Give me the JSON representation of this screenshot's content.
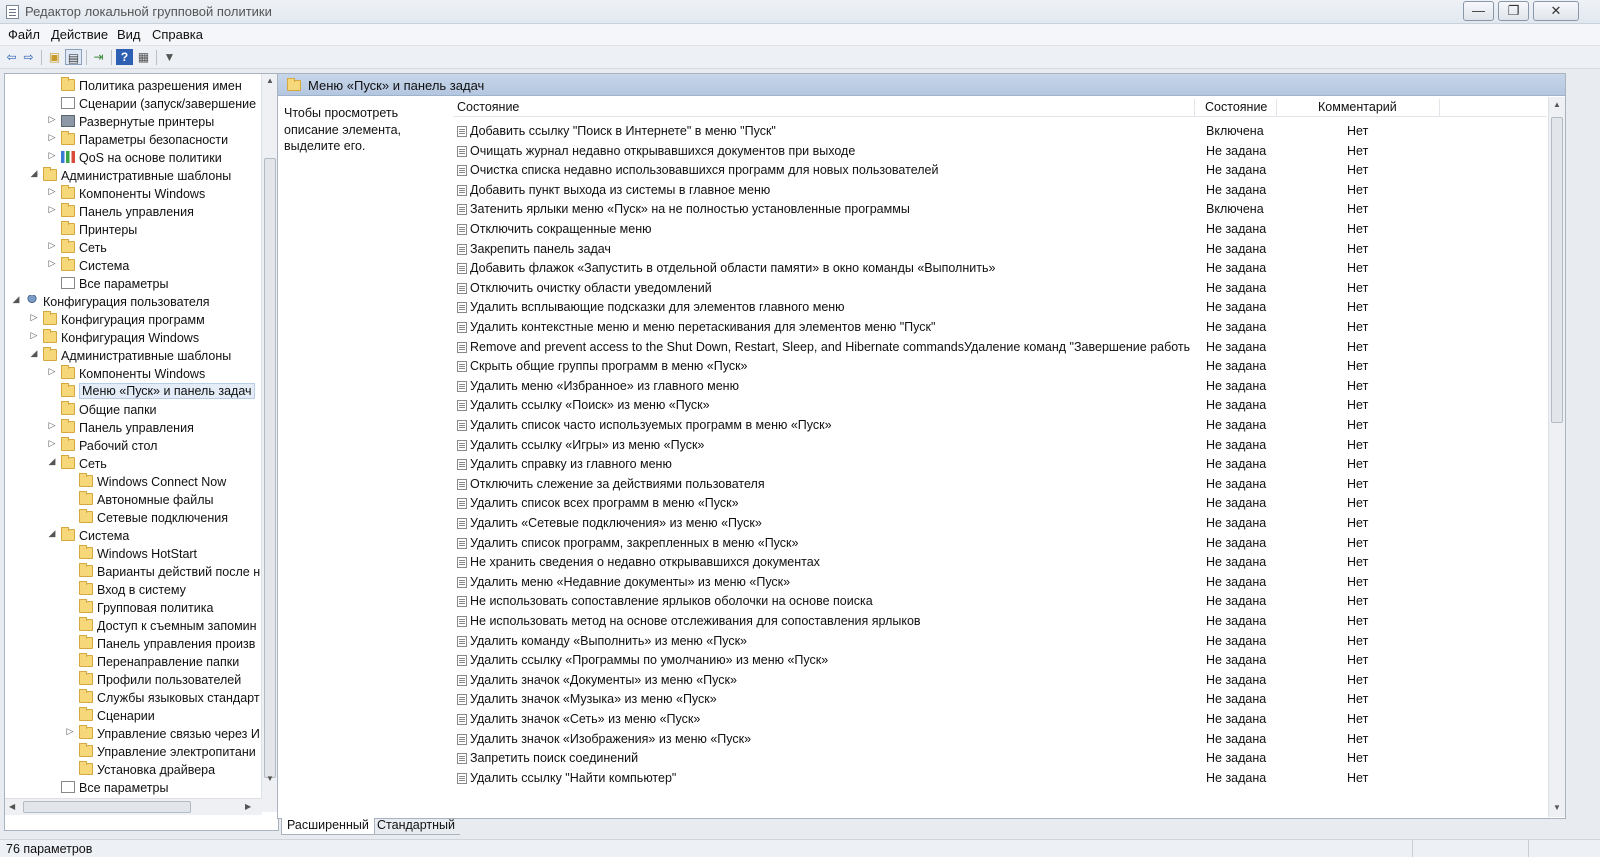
{
  "window": {
    "title": "Редактор локальной групповой политики",
    "minimize_glyph": "—",
    "restore_glyph": "❐",
    "close_glyph": "✕"
  },
  "menu": [
    "Файл",
    "Действие",
    "Вид",
    "Справка"
  ],
  "toolbar": {
    "icons": [
      "back-icon",
      "forward-icon",
      "up-folder-icon",
      "show-hide-tree-icon",
      "export-list-icon",
      "help-icon",
      "properties-icon",
      "filter-icon"
    ]
  },
  "tree": [
    {
      "label": "Политика разрешения имен",
      "level": 2,
      "expander": "",
      "icon": "folder"
    },
    {
      "label": "Сценарии (запуск/завершение",
      "level": 2,
      "expander": "",
      "icon": "doc"
    },
    {
      "label": "Развернутые принтеры",
      "level": 2,
      "expander": "▷",
      "icon": "printer"
    },
    {
      "label": "Параметры безопасности",
      "level": 2,
      "expander": "▷",
      "icon": "folder"
    },
    {
      "label": "QoS на основе политики",
      "level": 2,
      "expander": "▷",
      "icon": "chart"
    },
    {
      "label": "Административные шаблоны",
      "level": 1,
      "expander": "◢",
      "icon": "folder"
    },
    {
      "label": "Компоненты Windows",
      "level": 2,
      "expander": "▷",
      "icon": "folder"
    },
    {
      "label": "Панель управления",
      "level": 2,
      "expander": "▷",
      "icon": "folder"
    },
    {
      "label": "Принтеры",
      "level": 2,
      "expander": "",
      "icon": "folder"
    },
    {
      "label": "Сеть",
      "level": 2,
      "expander": "▷",
      "icon": "folder"
    },
    {
      "label": "Система",
      "level": 2,
      "expander": "▷",
      "icon": "folder"
    },
    {
      "label": "Все параметры",
      "level": 2,
      "expander": "",
      "icon": "doc"
    },
    {
      "label": "Конфигурация пользователя",
      "level": 0,
      "expander": "◢",
      "icon": "user"
    },
    {
      "label": "Конфигурация программ",
      "level": 1,
      "expander": "▷",
      "icon": "folder"
    },
    {
      "label": "Конфигурация Windows",
      "level": 1,
      "expander": "▷",
      "icon": "folder"
    },
    {
      "label": "Административные шаблоны",
      "level": 1,
      "expander": "◢",
      "icon": "folder"
    },
    {
      "label": "Компоненты Windows",
      "level": 2,
      "expander": "▷",
      "icon": "folder"
    },
    {
      "label": "Меню «Пуск» и панель задач",
      "level": 2,
      "expander": "",
      "icon": "folder",
      "selected": true
    },
    {
      "label": "Общие папки",
      "level": 2,
      "expander": "",
      "icon": "folder"
    },
    {
      "label": "Панель управления",
      "level": 2,
      "expander": "▷",
      "icon": "folder"
    },
    {
      "label": "Рабочий стол",
      "level": 2,
      "expander": "▷",
      "icon": "folder"
    },
    {
      "label": "Сеть",
      "level": 2,
      "expander": "◢",
      "icon": "folder"
    },
    {
      "label": "Windows Connect Now",
      "level": 3,
      "expander": "",
      "icon": "folder"
    },
    {
      "label": "Автономные файлы",
      "level": 3,
      "expander": "",
      "icon": "folder"
    },
    {
      "label": "Сетевые подключения",
      "level": 3,
      "expander": "",
      "icon": "folder"
    },
    {
      "label": "Система",
      "level": 2,
      "expander": "◢",
      "icon": "folder"
    },
    {
      "label": "Windows HotStart",
      "level": 3,
      "expander": "",
      "icon": "folder"
    },
    {
      "label": "Варианты действий после н",
      "level": 3,
      "expander": "",
      "icon": "folder"
    },
    {
      "label": "Вход в систему",
      "level": 3,
      "expander": "",
      "icon": "folder"
    },
    {
      "label": "Групповая политика",
      "level": 3,
      "expander": "",
      "icon": "folder"
    },
    {
      "label": "Доступ к съемным запомин",
      "level": 3,
      "expander": "",
      "icon": "folder"
    },
    {
      "label": "Панель управления произв",
      "level": 3,
      "expander": "",
      "icon": "folder"
    },
    {
      "label": "Перенаправление папки",
      "level": 3,
      "expander": "",
      "icon": "folder"
    },
    {
      "label": "Профили пользователей",
      "level": 3,
      "expander": "",
      "icon": "folder"
    },
    {
      "label": "Службы языковых стандарт",
      "level": 3,
      "expander": "",
      "icon": "folder"
    },
    {
      "label": "Сценарии",
      "level": 3,
      "expander": "",
      "icon": "folder"
    },
    {
      "label": "Управление связью через И",
      "level": 3,
      "expander": "▷",
      "icon": "folder"
    },
    {
      "label": "Управление электропитани",
      "level": 3,
      "expander": "",
      "icon": "folder"
    },
    {
      "label": "Установка драйвера",
      "level": 3,
      "expander": "",
      "icon": "folder"
    },
    {
      "label": "Все параметры",
      "level": 2,
      "expander": "",
      "icon": "doc"
    }
  ],
  "right": {
    "header": "Меню «Пуск» и панель задач",
    "description": "Чтобы просмотреть описание элемента, выделите его.",
    "columns": [
      "Состояние",
      "Состояние",
      "Комментарий"
    ],
    "rows": [
      [
        "Добавить ссылку \"Поиск в Интернете\" в меню \"Пуск\"",
        "Включена",
        "Нет"
      ],
      [
        "Очищать журнал недавно открывавшихся документов при выходе",
        "Не задана",
        "Нет"
      ],
      [
        "Очистка списка недавно использовавшихся программ для новых пользователей",
        "Не задана",
        "Нет"
      ],
      [
        "Добавить пункт выхода из системы в главное меню",
        "Не задана",
        "Нет"
      ],
      [
        "Затенить ярлыки меню «Пуск» на не полностью установленные программы",
        "Включена",
        "Нет"
      ],
      [
        "Отключить сокращенные меню",
        "Не задана",
        "Нет"
      ],
      [
        "Закрепить панель задач",
        "Не задана",
        "Нет"
      ],
      [
        "Добавить флажок «Запустить в отдельной области памяти» в окно команды «Выполнить»",
        "Не задана",
        "Нет"
      ],
      [
        "Отключить очистку области уведомлений",
        "Не задана",
        "Нет"
      ],
      [
        "Удалить всплывающие подсказки для элементов главного меню",
        "Не задана",
        "Нет"
      ],
      [
        "Удалить контекстные меню и меню перетаскивания для элементов меню \"Пуск\"",
        "Не задана",
        "Нет"
      ],
      [
        "Remove and prevent access to the Shut Down, Restart, Sleep, and Hibernate commandsУдаление команд \"Завершение работы\", \"...",
        "Не задана",
        "Нет"
      ],
      [
        "Скрыть общие группы программ в меню «Пуск»",
        "Не задана",
        "Нет"
      ],
      [
        "Удалить меню «Избранное» из главного меню",
        "Не задана",
        "Нет"
      ],
      [
        "Удалить ссылку «Поиск» из меню «Пуск»",
        "Не задана",
        "Нет"
      ],
      [
        "Удалить список часто используемых программ в меню «Пуск»",
        "Не задана",
        "Нет"
      ],
      [
        "Удалить ссылку «Игры» из меню «Пуск»",
        "Не задана",
        "Нет"
      ],
      [
        "Удалить справку из главного меню",
        "Не задана",
        "Нет"
      ],
      [
        "Отключить слежение за действиями пользователя",
        "Не задана",
        "Нет"
      ],
      [
        "Удалить список всех программ в меню «Пуск»",
        "Не задана",
        "Нет"
      ],
      [
        "Удалить «Сетевые подключения» из меню «Пуск»",
        "Не задана",
        "Нет"
      ],
      [
        "Удалить список программ, закрепленных в меню «Пуск»",
        "Не задана",
        "Нет"
      ],
      [
        "Не хранить сведения о недавно открывавшихся документах",
        "Не задана",
        "Нет"
      ],
      [
        "Удалить меню «Недавние документы» из меню «Пуск»",
        "Не задана",
        "Нет"
      ],
      [
        "Не использовать сопоставление ярлыков оболочки на основе поиска",
        "Не задана",
        "Нет"
      ],
      [
        "Не использовать метод на основе отслеживания для сопоставления ярлыков",
        "Не задана",
        "Нет"
      ],
      [
        "Удалить команду «Выполнить» из меню «Пуск»",
        "Не задана",
        "Нет"
      ],
      [
        "Удалить ссылку «Программы по умолчанию» из меню «Пуск»",
        "Не задана",
        "Нет"
      ],
      [
        "Удалить значок «Документы» из меню «Пуск»",
        "Не задана",
        "Нет"
      ],
      [
        "Удалить значок «Музыка» из меню «Пуск»",
        "Не задана",
        "Нет"
      ],
      [
        "Удалить значок «Сеть» из меню «Пуск»",
        "Не задана",
        "Нет"
      ],
      [
        "Удалить значок «Изображения» из меню «Пуск»",
        "Не задана",
        "Нет"
      ],
      [
        "Запретить поиск соединений",
        "Не задана",
        "Нет"
      ],
      [
        "Удалить ссылку \"Найти компьютер\"",
        "Не задана",
        "Нет"
      ]
    ]
  },
  "tabs": [
    "Расширенный",
    "Стандартный"
  ],
  "status": "76 параметров"
}
